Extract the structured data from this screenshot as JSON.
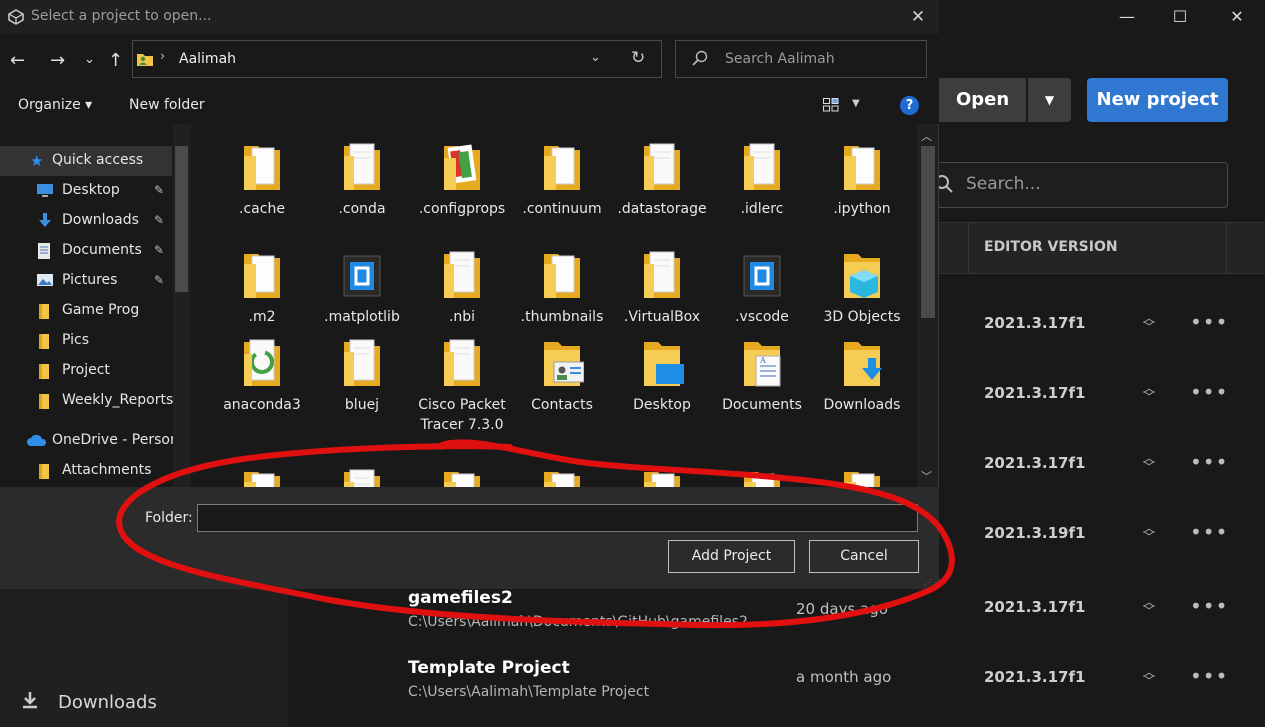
{
  "hub": {
    "window_controls": {
      "minimize": "—",
      "maximize": "☐",
      "close": "✕"
    },
    "open_label": "Open",
    "open_caret": "▼",
    "new_project_label": "New project",
    "search_placeholder": "Search...",
    "col_editor_version": "EDITOR VERSION",
    "rows": [
      {
        "name": "",
        "path": "",
        "time": "",
        "version": "2021.3.17f1"
      },
      {
        "name": "",
        "path": "",
        "time": "",
        "version": "2021.3.17f1"
      },
      {
        "name": "",
        "path": "",
        "time": "",
        "version": "2021.3.17f1"
      },
      {
        "name": "",
        "path": "",
        "time": "",
        "version": "2021.3.19f1"
      },
      {
        "name": "gamefiles2",
        "path": "C:\\Users\\Aalimah\\Documents\\GitHub\\gamefiles2",
        "time": "20 days ago",
        "version": "2021.3.17f1"
      },
      {
        "name": "Template Project",
        "path": "C:\\Users\\Aalimah\\Template Project",
        "time": "a month ago",
        "version": "2021.3.17f1"
      }
    ],
    "more_glyph": "•••",
    "sidebar_downloads": "Downloads"
  },
  "dialog": {
    "title": "Select a project to open...",
    "nav": {
      "back": "←",
      "forward": "→",
      "recent": "⌄",
      "up": "↑"
    },
    "address": {
      "chevron": "›",
      "path": "Aalimah",
      "dropdown": "⌄",
      "refresh": "↻"
    },
    "search_placeholder": "Search Aalimah",
    "toolbar": {
      "organize": "Organize ▾",
      "new_folder": "New folder",
      "help": "?",
      "view_caret": "▼"
    },
    "nav_pane": [
      {
        "key": "quick",
        "label": "Quick access",
        "icon": "star-icon",
        "pinned": false
      },
      {
        "key": "desktop",
        "label": "Desktop",
        "icon": "desktop-icon",
        "pinned": true
      },
      {
        "key": "downloads",
        "label": "Downloads",
        "icon": "download-icon",
        "pinned": true
      },
      {
        "key": "documents",
        "label": "Documents",
        "icon": "documents-icon",
        "pinned": true
      },
      {
        "key": "pictures",
        "label": "Pictures",
        "icon": "pictures-icon",
        "pinned": true
      },
      {
        "key": "gameprog",
        "label": "Game Prog",
        "icon": "folder-icon",
        "pinned": false
      },
      {
        "key": "pics",
        "label": "Pics",
        "icon": "folder-icon",
        "pinned": false
      },
      {
        "key": "project",
        "label": "Project",
        "icon": "folder-icon",
        "pinned": false
      },
      {
        "key": "weekly",
        "label": "Weekly_Reports",
        "icon": "folder-icon",
        "pinned": false
      },
      {
        "key": "onedrive",
        "label": "OneDrive - Person",
        "icon": "cloud-icon",
        "pinned": false
      },
      {
        "key": "attachments",
        "label": "Attachments",
        "icon": "folder-icon",
        "pinned": false
      }
    ],
    "pin_glyph": "📌",
    "files": [
      {
        "label": ".cache",
        "kind": "folder"
      },
      {
        "label": ".conda",
        "kind": "folder-doc"
      },
      {
        "label": ".configprops",
        "kind": "folder-color"
      },
      {
        "label": ".continuum",
        "kind": "folder"
      },
      {
        "label": ".datastorage",
        "kind": "folder-doc"
      },
      {
        "label": ".idlerc",
        "kind": "folder-doc"
      },
      {
        "label": ".ipython",
        "kind": "folder"
      },
      {
        "label": ".m2",
        "kind": "folder"
      },
      {
        "label": ".matplotlib",
        "kind": "vscode"
      },
      {
        "label": ".nbi",
        "kind": "folder-doc"
      },
      {
        "label": ".thumbnails",
        "kind": "folder"
      },
      {
        "label": ".VirtualBox",
        "kind": "folder-doc"
      },
      {
        "label": ".vscode",
        "kind": "vscode"
      },
      {
        "label": "3D Objects",
        "kind": "3d"
      },
      {
        "label": "anaconda3",
        "kind": "anaconda"
      },
      {
        "label": "bluej",
        "kind": "folder-doc"
      },
      {
        "label": "Cisco Packet Tracer 7.3.0",
        "kind": "folder-doc"
      },
      {
        "label": "Contacts",
        "kind": "contacts"
      },
      {
        "label": "Desktop",
        "kind": "desktop"
      },
      {
        "label": "Documents",
        "kind": "documents"
      },
      {
        "label": "Downloads",
        "kind": "downloads"
      },
      {
        "label": "",
        "kind": "folder"
      },
      {
        "label": "",
        "kind": "folder-doc"
      },
      {
        "label": "",
        "kind": "folder"
      },
      {
        "label": "",
        "kind": "folder"
      },
      {
        "label": "",
        "kind": "folder"
      },
      {
        "label": "",
        "kind": "folder"
      },
      {
        "label": "",
        "kind": "folder"
      }
    ],
    "folder_label": "Folder:",
    "folder_value": "",
    "add_project_label": "Add Project",
    "cancel_label": "Cancel"
  },
  "colors": {
    "accent_blue": "#2f77d1",
    "annotation_red": "#e01010",
    "folder_yellow": "#f3c443"
  }
}
